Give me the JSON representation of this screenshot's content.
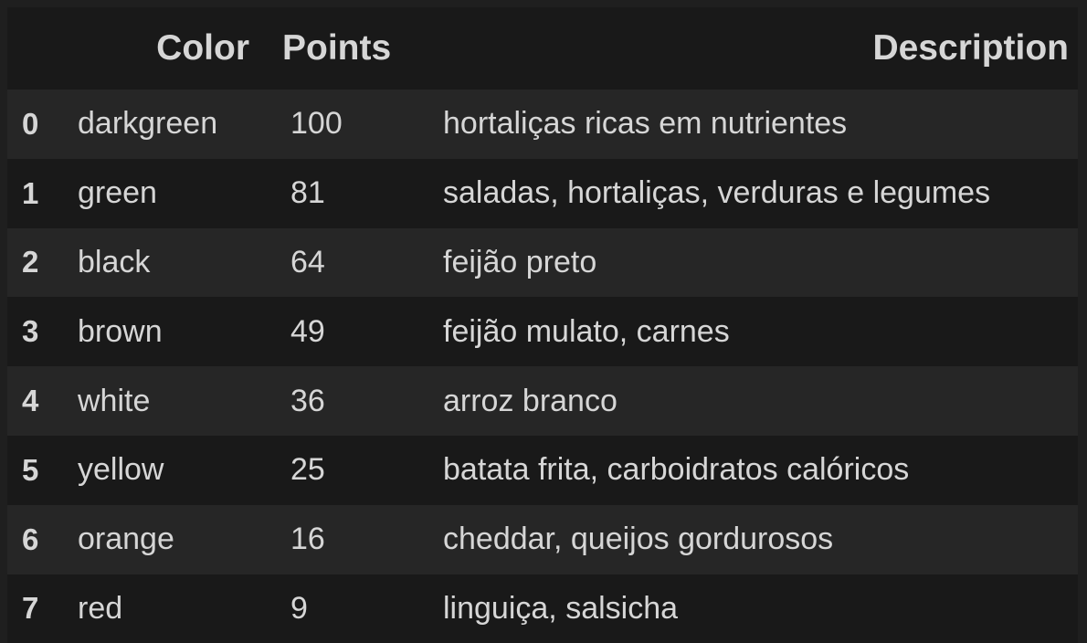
{
  "table": {
    "columns": {
      "index": "",
      "color": "Color",
      "points": "Points",
      "description": "Description"
    },
    "rows": [
      {
        "index": "0",
        "color": "darkgreen",
        "points": "100",
        "description": "hortaliças ricas em nutrientes"
      },
      {
        "index": "1",
        "color": "green",
        "points": "81",
        "description": "saladas, hortaliças, verduras e legumes"
      },
      {
        "index": "2",
        "color": "black",
        "points": "64",
        "description": "feijão preto"
      },
      {
        "index": "3",
        "color": "brown",
        "points": "49",
        "description": "feijão mulato, carnes"
      },
      {
        "index": "4",
        "color": "white",
        "points": "36",
        "description": "arroz branco"
      },
      {
        "index": "5",
        "color": "yellow",
        "points": "25",
        "description": "batata frita, carboidratos calóricos"
      },
      {
        "index": "6",
        "color": "orange",
        "points": "16",
        "description": "cheddar, queijos gordurosos"
      },
      {
        "index": "7",
        "color": "red",
        "points": "9",
        "description": "linguiça, salsicha"
      }
    ]
  },
  "theme": {
    "background": "#191919",
    "row_alt": "#262626",
    "text": "#d6d6d6"
  }
}
